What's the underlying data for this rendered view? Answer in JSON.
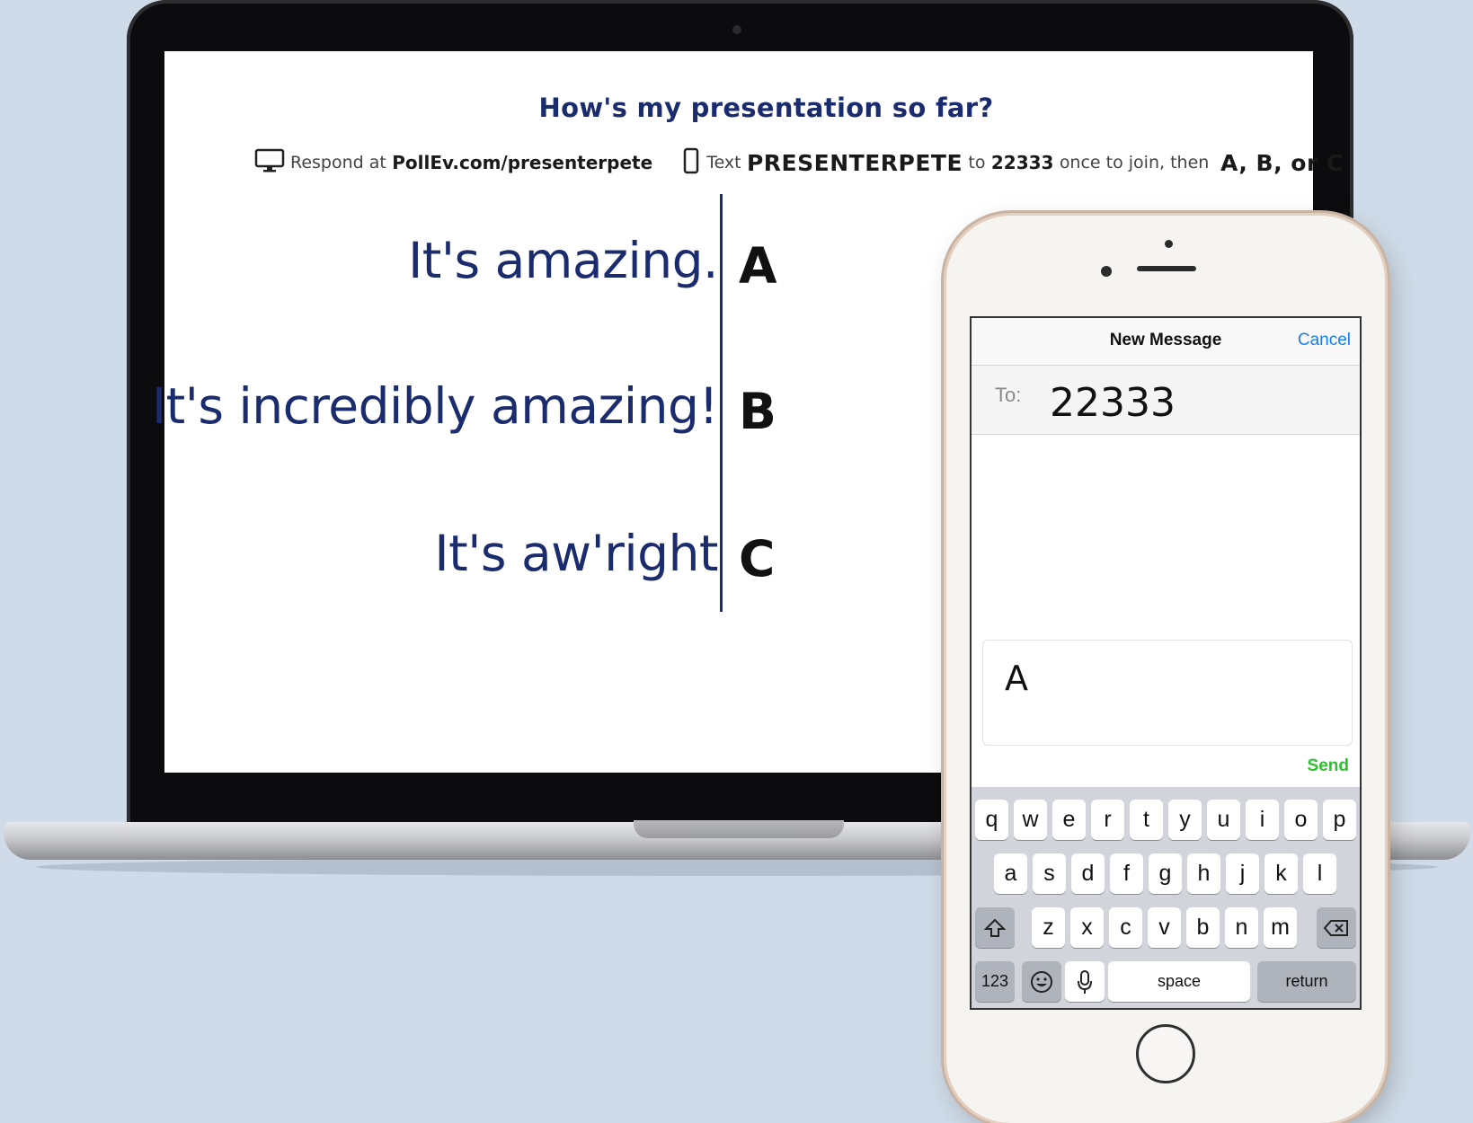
{
  "slide": {
    "title": "How's my presentation so far?",
    "respond_label": "Respond at",
    "respond_url": "PollEv.com/presenterpete",
    "text_label": "Text",
    "keyword": "PRESENTERPETE",
    "to_label": "to",
    "number": "22333",
    "join_text": "once to join, then",
    "choices_hint": "A, B, or C",
    "options": [
      {
        "text": "It's amazing.",
        "letter": "A"
      },
      {
        "text": "It's incredibly amazing!",
        "letter": "B"
      },
      {
        "text": "It's aw'right",
        "letter": "C"
      }
    ]
  },
  "phone": {
    "nav_title": "New Message",
    "cancel_label": "Cancel",
    "to_label": "To:",
    "to_value": "22333",
    "message_text": "A",
    "send_label": "Send",
    "keyboard": {
      "row1": [
        "q",
        "w",
        "e",
        "r",
        "t",
        "y",
        "u",
        "i",
        "o",
        "p"
      ],
      "row2": [
        "a",
        "s",
        "d",
        "f",
        "g",
        "h",
        "j",
        "k",
        "l"
      ],
      "row3": [
        "z",
        "x",
        "c",
        "v",
        "b",
        "n",
        "m"
      ],
      "numbers_key": "123",
      "space_key": "space",
      "return_key": "return"
    }
  },
  "colors": {
    "background": "#cfdbe8",
    "slide_text": "#1b2c6e",
    "ios_blue": "#1a7cf5",
    "send_green": "#2dc12f"
  }
}
